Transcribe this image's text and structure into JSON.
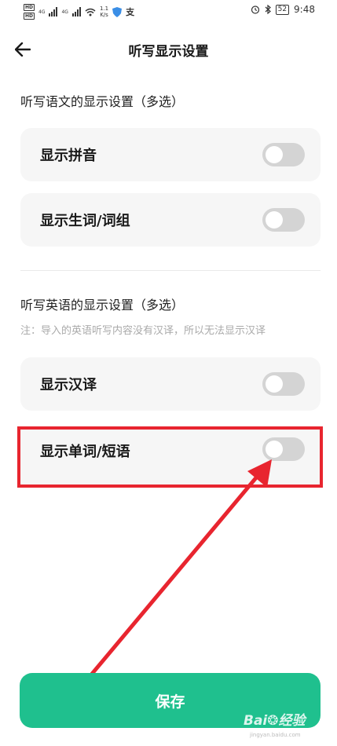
{
  "status_bar": {
    "hd_labels": [
      "HD",
      "HD"
    ],
    "network": "4G",
    "network2": "4G",
    "net_speed": "1.1",
    "net_unit": "K/s",
    "battery": "52",
    "time": "9:48",
    "icons": [
      "alarm-icon",
      "bluetooth-icon",
      "wifi-icon",
      "shield-icon",
      "alipay-icon"
    ]
  },
  "header": {
    "title": "听写显示设置",
    "back_icon": "arrow-left-icon"
  },
  "chinese_section": {
    "title": "听写语文的显示设置（多选）",
    "options": [
      {
        "label": "显示拼音",
        "enabled": false
      },
      {
        "label": "显示生词/词组",
        "enabled": false
      }
    ]
  },
  "english_section": {
    "title": "听写英语的显示设置（多选）",
    "note": "注：导入的英语听写内容没有汉译，所以无法显示汉译",
    "options": [
      {
        "label": "显示汉译",
        "enabled": false
      },
      {
        "label": "显示单词/短语",
        "enabled": false
      }
    ]
  },
  "save_button": {
    "label": "保存"
  },
  "watermark": {
    "brand": "Bai",
    "brand2": "经验",
    "site": "jingyan.baidu.com"
  },
  "colors": {
    "accent": "#1fc08e",
    "card_bg": "#f6f6f6",
    "toggle_off": "#d4d4d4",
    "annotation_red": "#e8252f",
    "note_gray": "#aaaaaa"
  }
}
